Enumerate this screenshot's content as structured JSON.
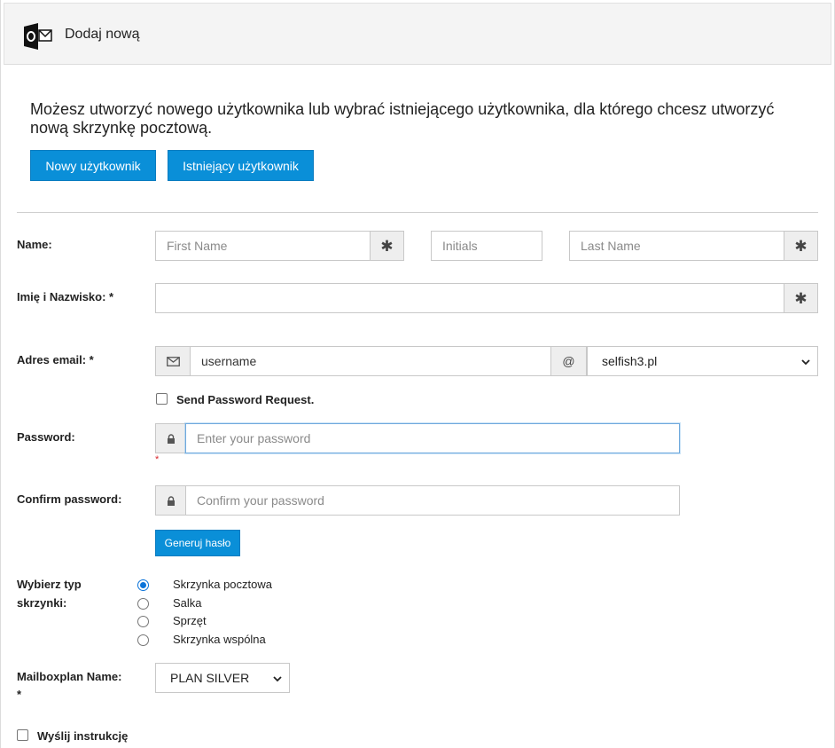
{
  "header": {
    "title": "Dodaj nową",
    "icon": "outlook-icon"
  },
  "intro": {
    "text": "Możesz utworzyć nowego użytkownika lub wybrać istniejącego użytkownika, dla którego chcesz utworzyć nową skrzynkę pocztową."
  },
  "buttons": {
    "new_user": "Nowy użytkownik",
    "existing_user": "Istniejący użytkownik",
    "generate_password": "Generuj hasło"
  },
  "form": {
    "name_label": "Name:",
    "first_name_placeholder": "First Name",
    "initials_placeholder": "Initials",
    "last_name_placeholder": "Last Name",
    "full_name_label": "Imię i Nazwisko: *",
    "full_name_value": "",
    "email_label": "Adres email: *",
    "email_username": "username",
    "email_at": "@",
    "email_domain": "selfish3.pl",
    "send_password_request": "Send Password Request.",
    "password_label": "Password:",
    "password_placeholder": "Enter your password",
    "password_required_mark": "*",
    "confirm_label": "Confirm password:",
    "confirm_placeholder": "Confirm your password",
    "mailbox_type_label_line1": "Wybierz typ",
    "mailbox_type_label_line2": "skrzynki:",
    "mailbox_types": [
      "Skrzynka pocztowa",
      "Salka",
      "Sprzęt",
      "Skrzynka wspólna"
    ],
    "mailbox_type_selected": "Skrzynka pocztowa",
    "mailboxplan_label": "Mailboxplan Name:",
    "mailboxplan_required": "*",
    "mailboxplan_value": "PLAN SILVER",
    "send_instructions": "Wyślij instrukcję"
  },
  "colors": {
    "accent": "#0a8fd8",
    "radio": "#0b73d9",
    "required": "#d9262c"
  }
}
